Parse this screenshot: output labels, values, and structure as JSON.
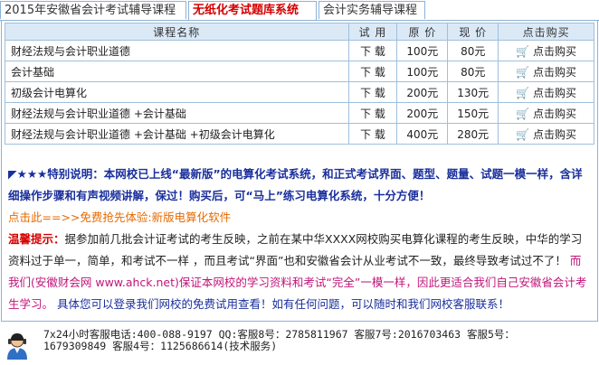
{
  "tabs": [
    {
      "label": "2015年安徽省会计考试辅导课程",
      "active": false
    },
    {
      "label": "无纸化考试题库系统",
      "active": true
    },
    {
      "label": "会计实务辅导课程",
      "active": false
    }
  ],
  "table": {
    "headers": [
      "课程名称",
      "试 用",
      "原 价",
      "现 价",
      "点击购买"
    ],
    "rows": [
      {
        "name": "财经法规与会计职业道德",
        "trial": "下 载",
        "original": "100元",
        "current": "80元",
        "buy": "点击购买"
      },
      {
        "name": "会计基础",
        "trial": "下 载",
        "original": "100元",
        "current": "80元",
        "buy": "点击购买"
      },
      {
        "name": "初级会计电算化",
        "trial": "下 载",
        "original": "200元",
        "current": "130元",
        "buy": "点击购买"
      },
      {
        "name": "财经法规与会计职业道德 +会计基础",
        "trial": "下 载",
        "original": "200元",
        "current": "150元",
        "buy": "点击购买"
      },
      {
        "name": "财经法规与会计职业道德 +会计基础 +初级会计电算化",
        "trial": "下 载",
        "original": "400元",
        "current": "280元",
        "buy": "点击购买"
      }
    ]
  },
  "notice": {
    "special_marker": "◤★★★特别说明：",
    "special_text": "本网校已上线“最新版”的电算化考试系统，和正式考试界面、题型、题量、试题一模一样，含详细操作步骤和有声视频讲解，保过！购买后，可“马上”练习电算化系统，十分方便！",
    "trial_link": "点击此==>>免费抢先体验:新版电算化软件",
    "tip_label": "温馨提示：",
    "tip_text": "据参加前几批会计证考试的考生反映，之前在某中华XXXX网校购买电算化课程的考生反映，中华的学习资料过于单一，简单，和考试不一样 ，而且考试“界面”也和安徽省会计从业考试不一致，最终导致考试过不了！",
    "tip_pink": "而我们(安徽财会网 www.ahck.net)保证本网校的学习资料和考试“完全”一模一样，因此更适合我们自己安徽省会计考生学习。",
    "tip_blue": "具体您可以登录我们网校的免费试用查看！如有任何问题，可以随时和我们网校客服联系！"
  },
  "footer": {
    "line1": "7x24小时客服电话:400-088-9197 QQ:客服8号：2785811967 客服7号:2016703463 客服5号：",
    "line2": "1679309849 客服4号：1125686614(技术服务)"
  },
  "colors": {
    "accent_red": "#d40000",
    "link_orange": "#e66a00",
    "pink": "#c0157a",
    "navy": "#1a2f9c",
    "border_blue": "#9fbfdc"
  }
}
